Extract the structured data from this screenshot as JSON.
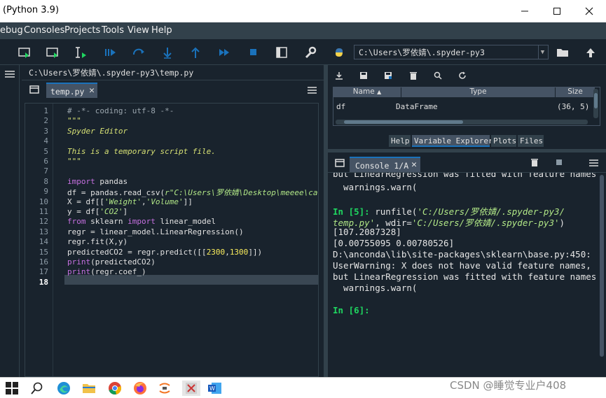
{
  "window": {
    "title": "(Python 3.9)",
    "minimize_icon": "minimize-icon",
    "maximize_icon": "maximize-icon",
    "close_icon": "close-icon"
  },
  "menu": {
    "items": [
      "ebug",
      "Consoles",
      "Projects",
      "Tools",
      "View",
      "Help"
    ]
  },
  "toolbar": {
    "icons": [
      "run-file-icon",
      "run-cell-icon",
      "debug-icon",
      "continue-icon",
      "step-over-icon",
      "step-into-icon",
      "step-return-icon",
      "debug-continue-icon",
      "stop-icon",
      "maximize-pane-icon",
      "preferences-wrench-icon",
      "python-path-icon"
    ],
    "working_directory": "C:\\Users\\罗依婧\\.spyder-py3",
    "browse_icon": "folder-icon",
    "parent_dir_icon": "up-arrow-icon"
  },
  "editor": {
    "file_path": "C:\\Users\\罗依婧\\.spyder-py3\\temp.py",
    "tab_label": "temp.py",
    "current_line": "18",
    "line_numbers": [
      "1",
      "2",
      "3",
      "4",
      "5",
      "6",
      "7",
      "8",
      "9",
      "10",
      "11",
      "12",
      "13",
      "14",
      "15",
      "16",
      "17",
      "18"
    ]
  },
  "variable_explorer": {
    "columns": [
      "Name",
      "Type",
      "Size"
    ],
    "rows": [
      {
        "name": "df",
        "type": "DataFrame",
        "size": "(36, 5)"
      }
    ],
    "tabs": [
      "Help",
      "Variable Explorer",
      "Plots",
      "Files"
    ],
    "active_tab": "Variable Explorer"
  },
  "console": {
    "tab_label": "Console 1/A"
  },
  "taskbar": {
    "icons": [
      "windows-start-icon",
      "search-icon",
      "edge-icon",
      "file-explorer-icon",
      "chrome-icon",
      "firefox-icon",
      "jupyter-icon",
      "app-icon",
      "word-icon"
    ]
  },
  "watermark": "CSDN @睡觉专业户408",
  "colors": {
    "background": "#19232d",
    "panel": "#32414b",
    "accent": "#1a72bb",
    "prompt": "#1fd660"
  }
}
